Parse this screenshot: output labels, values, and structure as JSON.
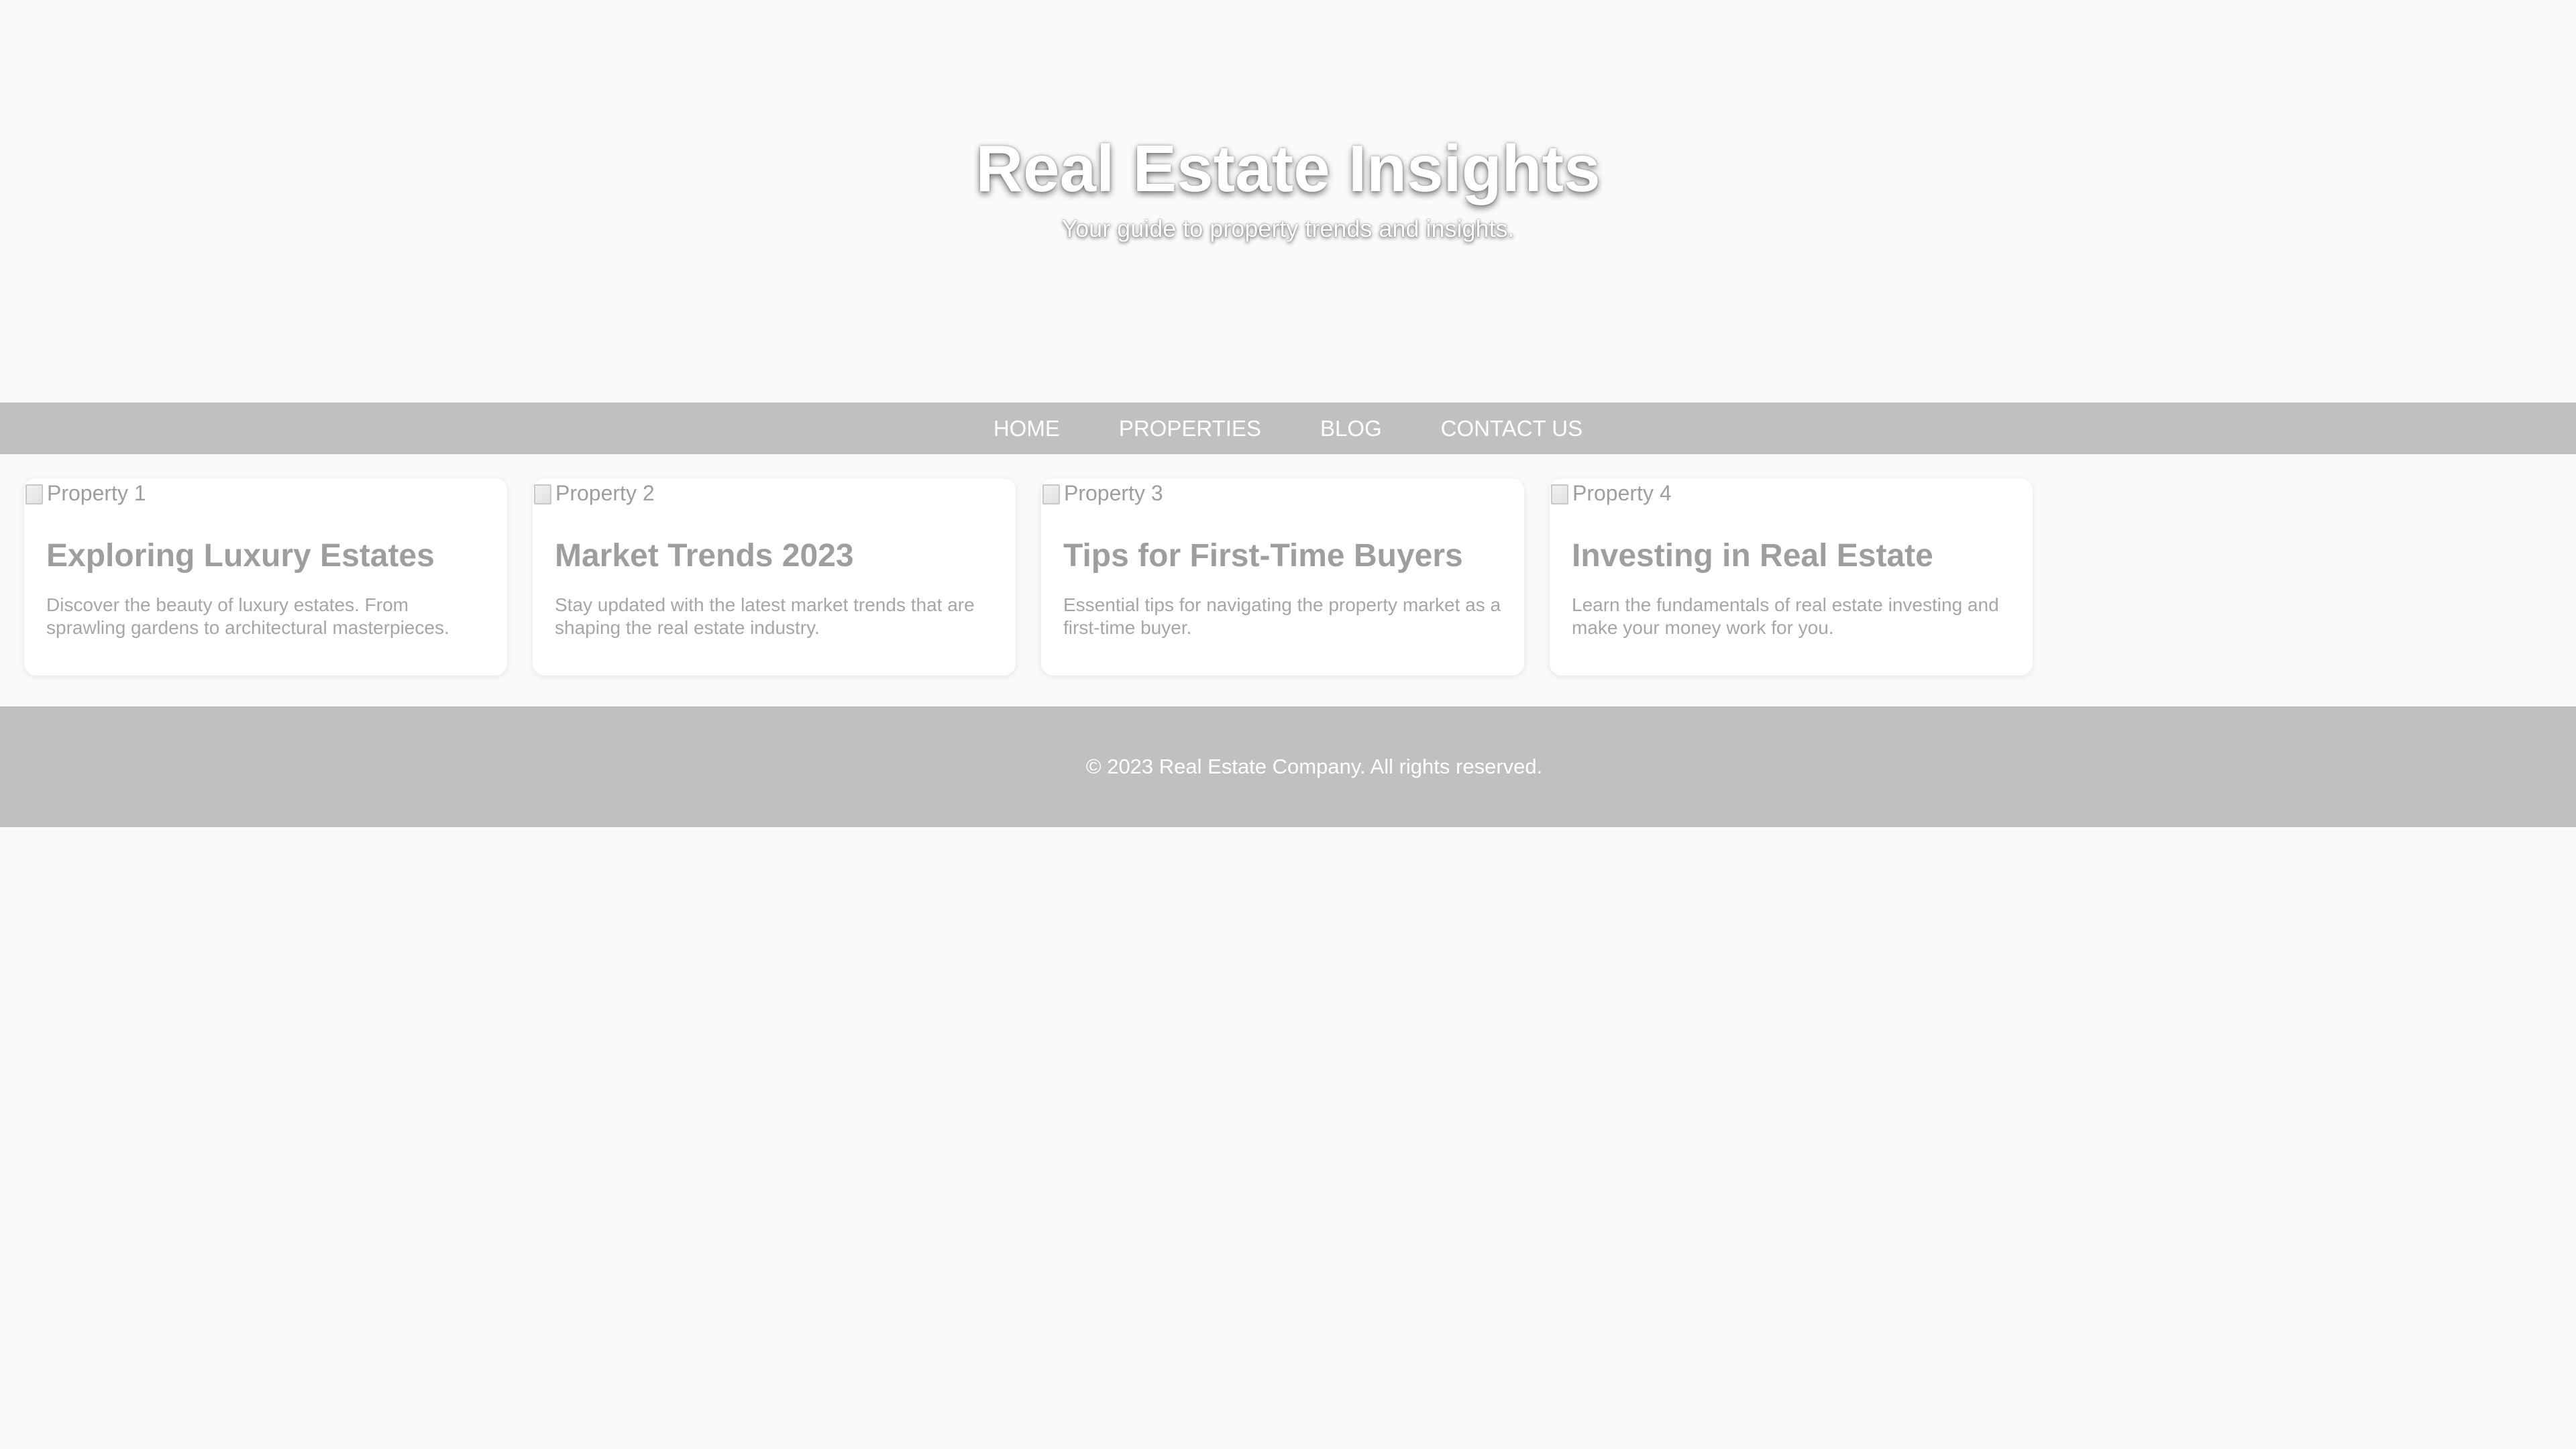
{
  "header": {
    "title": "Real Estate Insights",
    "subtitle": "Your guide to property trends and insights."
  },
  "nav": {
    "items": [
      {
        "label": "HOME"
      },
      {
        "label": "PROPERTIES"
      },
      {
        "label": "BLOG"
      },
      {
        "label": "CONTACT US"
      }
    ]
  },
  "cards": [
    {
      "image_alt": "Property 1",
      "title": "Exploring Luxury Estates",
      "description": "Discover the beauty of luxury estates. From sprawling gardens to architectural masterpieces."
    },
    {
      "image_alt": "Property 2",
      "title": "Market Trends 2023",
      "description": "Stay updated with the latest market trends that are shaping the real estate industry."
    },
    {
      "image_alt": "Property 3",
      "title": "Tips for First-Time Buyers",
      "description": "Essential tips for navigating the property market as a first-time buyer."
    },
    {
      "image_alt": "Property 4",
      "title": "Investing in Real Estate",
      "description": "Learn the fundamentals of real estate investing and make your money work for you."
    }
  ],
  "footer": {
    "text": "© 2023 Real Estate Company. All rights reserved."
  },
  "colors": {
    "background": "#fafafa",
    "bar": "#c0c0c0",
    "text_muted": "#9e9e9e",
    "white": "#ffffff"
  }
}
